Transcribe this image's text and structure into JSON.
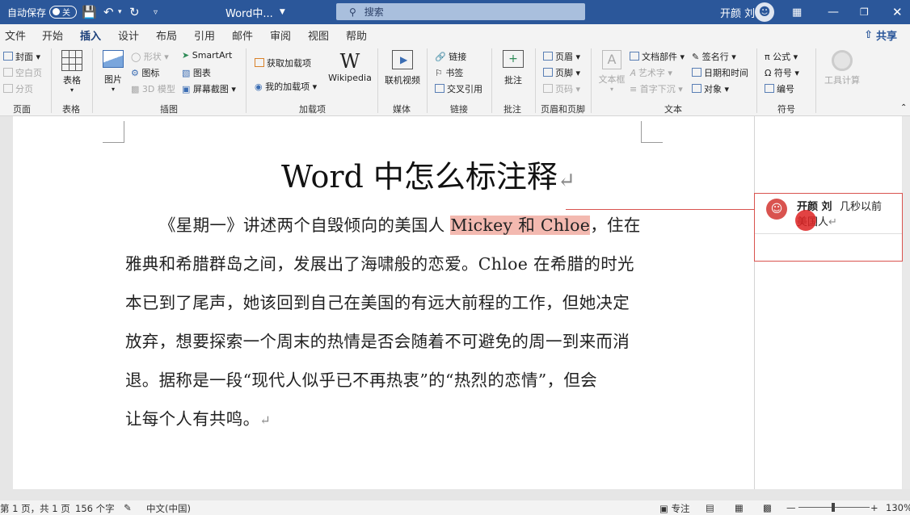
{
  "titlebar": {
    "autosave_label": "自动保存",
    "autosave_state": "关",
    "doc_title": "Word中...",
    "search_placeholder": "搜索",
    "user_name": "开颜 刘"
  },
  "menu": {
    "tabs": [
      "文件",
      "开始",
      "插入",
      "设计",
      "布局",
      "引用",
      "邮件",
      "审阅",
      "视图",
      "帮助"
    ],
    "active": "插入",
    "share_label": "共享"
  },
  "ribbon": {
    "pages": {
      "cover": "封面",
      "blank": "空白页",
      "break": "分页",
      "group": "页面"
    },
    "table": {
      "table": "表格",
      "group": "表格"
    },
    "illustrations": {
      "pictures": "图片",
      "shapes": "形状",
      "icons": "图标",
      "model3d": "3D 模型",
      "smartart": "SmartArt",
      "chart": "图表",
      "screenshot": "屏幕截图",
      "group": "插图"
    },
    "addins": {
      "get": "获取加载项",
      "my": "我的加载项",
      "wikipedia": "Wikipedia",
      "group": "加载项"
    },
    "media": {
      "video": "联机视频",
      "group": "媒体"
    },
    "links": {
      "link": "链接",
      "bookmark": "书签",
      "crossref": "交叉引用",
      "group": "链接"
    },
    "comments": {
      "comment": "批注",
      "group": "批注"
    },
    "headerfooter": {
      "header": "页眉",
      "footer": "页脚",
      "pagenum": "页码",
      "group": "页眉和页脚"
    },
    "text": {
      "textbox": "文本框",
      "parts": "文档部件",
      "wordart": "艺术字",
      "dropcap": "首字下沉",
      "sigline": "签名行",
      "datetime": "日期和时间",
      "object": "对象",
      "group": "文本"
    },
    "symbols": {
      "equation": "公式",
      "symbol": "符号",
      "number": "编号",
      "group": "符号"
    },
    "tools": {
      "calc": "工具计算"
    }
  },
  "document": {
    "title": "Word 中怎么标注释",
    "lines": [
      {
        "pre": "《星期一》讲述两个自毁倾向的美国人 ",
        "hl": "Mickey 和 Chloe",
        "post": "，住在"
      },
      {
        "pre": "雅典和希腊群岛之间，发展出了海啸般的恋爱。Chloe 在希腊的时光",
        "hl": "",
        "post": ""
      },
      {
        "pre": "本已到了尾声，她该回到自己在美国的有远大前程的工作，但她决定",
        "hl": "",
        "post": ""
      },
      {
        "pre": "放弃，想要探索一个周末的热情是否会随着不可避免的周一到来而消",
        "hl": "",
        "post": ""
      },
      {
        "pre": "退。据称是一段“现代人似乎已不再热衷”的“热烈的恋情”，但会",
        "hl": "",
        "post": ""
      },
      {
        "pre": "让每个人有共鸣。",
        "hl": "",
        "post": ""
      }
    ]
  },
  "comment": {
    "author": "开颜 刘",
    "time": "几秒以前",
    "text": "美国人"
  },
  "status": {
    "page": "第 1 页，共 1 页",
    "words": "156 个字",
    "lang": "中文(中国)",
    "focus": "专注",
    "zoom": "130%"
  },
  "colors": {
    "brand": "#2b579a",
    "comment": "#d9534f",
    "highlight": "#f3b9b0"
  }
}
